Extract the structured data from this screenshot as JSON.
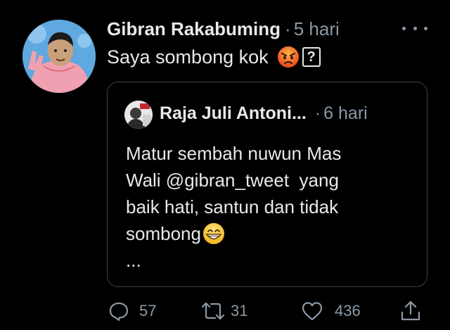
{
  "tweet": {
    "author_name": "Gibran Rakabuming",
    "separator": "·",
    "timestamp": "5 hari",
    "text": "Saya sombong kok",
    "unknown_glyph": "?",
    "emoji": "angry-face-emoji"
  },
  "quoted_tweet": {
    "author_name": "Raja Juli Antoni...",
    "separator": "·",
    "timestamp": "6 hari",
    "lines": [
      "Matur sembah nuwun Mas",
      "Wali @gibran_tweet  yang",
      "baik hati, santun dan tidak",
      "sombong"
    ],
    "ellipsis": "...",
    "emoji": "grinning-face-emoji"
  },
  "actions": {
    "reply_count": "57",
    "retweet_count": "31",
    "like_count": "436"
  },
  "colors": {
    "background": "#000000",
    "text_primary": "#e7e9ea",
    "text_secondary": "#8b98a5",
    "border": "#3a3f44"
  }
}
